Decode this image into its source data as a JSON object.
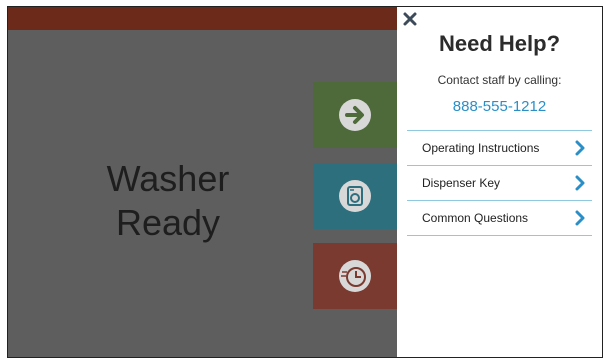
{
  "machine": {
    "status_line1": "Washer",
    "status_line2": "Ready"
  },
  "tiles": [
    {
      "name": "next-button",
      "icon": "arrow-right-icon",
      "color": "#4e6a3a"
    },
    {
      "name": "washer-button",
      "icon": "washer-icon",
      "color": "#2e6f7e"
    },
    {
      "name": "timer-button",
      "icon": "clock-icon",
      "color": "#7a3a30"
    }
  ],
  "help_panel": {
    "close_icon": "close-icon",
    "title": "Need Help?",
    "contact_label": "Contact staff by calling:",
    "phone": "888-555-1212",
    "items": [
      {
        "label": "Operating Instructions"
      },
      {
        "label": "Dispenser Key"
      },
      {
        "label": "Common Questions"
      }
    ]
  },
  "colors": {
    "accent": "#2a8fc7",
    "divider": "#8fc9df",
    "header_bar": "#6b2a1a"
  }
}
